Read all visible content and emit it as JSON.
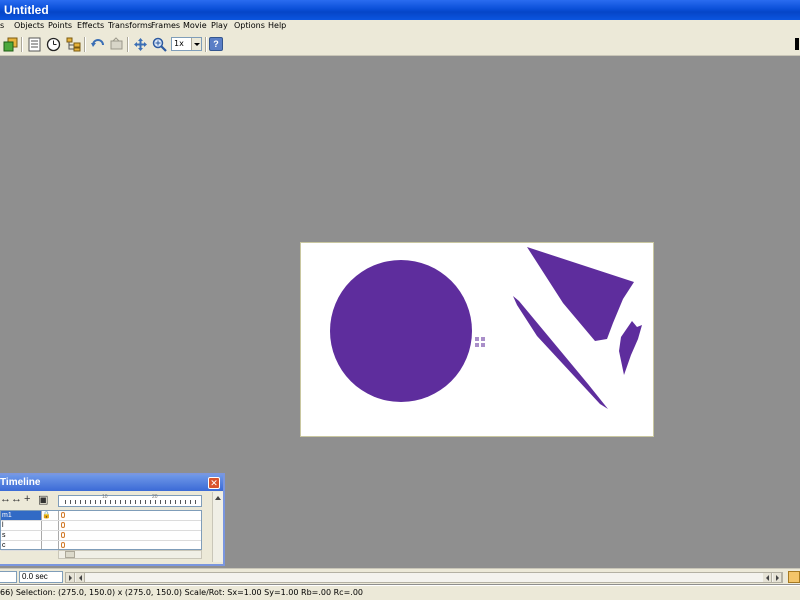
{
  "window": {
    "title": "Untitled"
  },
  "menu": {
    "items": [
      "s",
      "Objects",
      "Points",
      "Effects",
      "Transforms",
      "Frames",
      "Movie",
      "Play",
      "Options",
      "Help"
    ]
  },
  "toolbar": {
    "icons": [
      "add-object-icon",
      "properties-icon",
      "clock-icon",
      "tree-icon",
      "undo-icon",
      "redo-icon",
      "move-icon",
      "zoom-icon"
    ],
    "zoom_value": "1x",
    "help_label": "?"
  },
  "stage": {
    "background": "#ffffff",
    "shape_color": "#5e2d9d",
    "shapes": [
      "circle",
      "polygon-upper",
      "sliver",
      "leaf"
    ]
  },
  "timeline": {
    "title": "Timeline",
    "close_label": "✕",
    "ruler_marks": [
      "10",
      "20"
    ],
    "rows": [
      {
        "name": "m1",
        "lock": "🔒"
      },
      {
        "name": "l",
        "lock": ""
      },
      {
        "name": "s",
        "lock": ""
      },
      {
        "name": "c",
        "lock": ""
      }
    ]
  },
  "timebar": {
    "time_value": "0.0 sec"
  },
  "status": {
    "text": "66)  Selection: (275.0, 150.0) x (275.0, 150.0)  Scale/Rot: Sx=1.00 Sy=1.00 Rb=.00 Rc=.00"
  }
}
